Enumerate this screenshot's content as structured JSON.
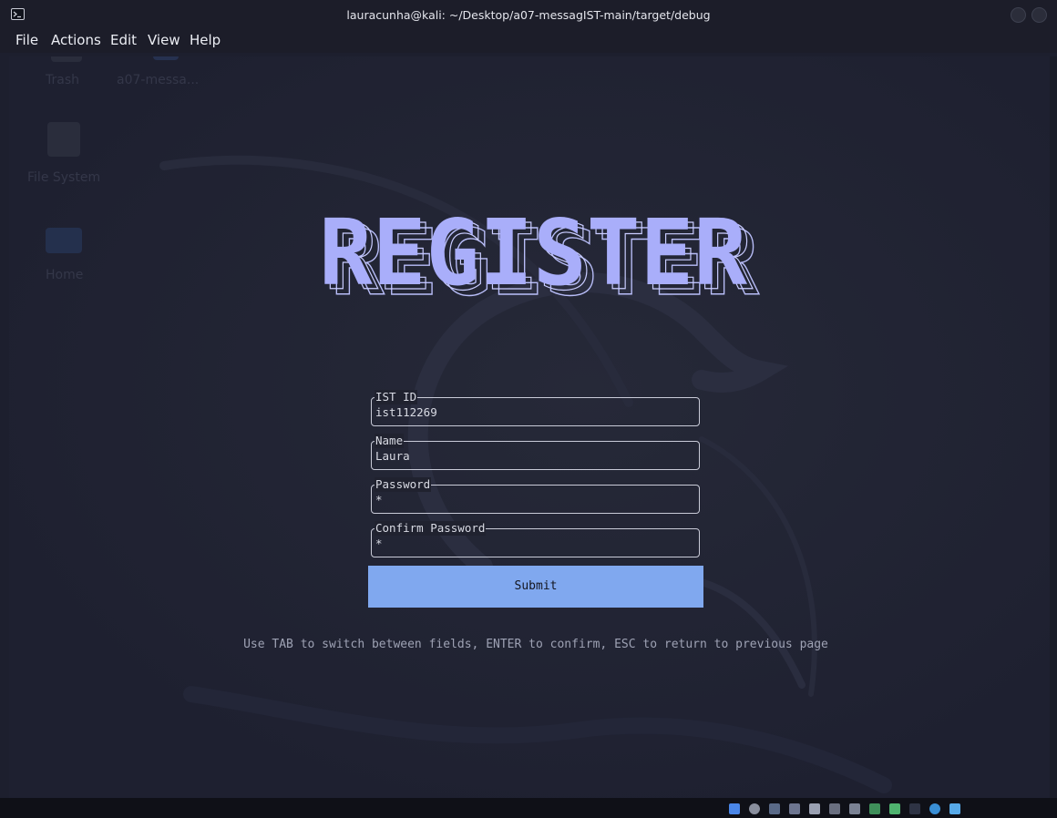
{
  "window": {
    "title": "lauracunha@kali: ~/Desktop/a07-messagIST-main/target/debug"
  },
  "menu": {
    "items": [
      "File",
      "Actions",
      "Edit",
      "View",
      "Help"
    ]
  },
  "desktop_ghosts": {
    "trash": "Trash",
    "folder": "a07-messa...",
    "filesystem": "File System",
    "home": "Home"
  },
  "screen": {
    "banner_text": "REGISTER",
    "fields": [
      {
        "label": "IST ID",
        "value": "ist112269"
      },
      {
        "label": "Name",
        "value": "Laura"
      },
      {
        "label": "Password",
        "value": "*"
      },
      {
        "label": "Confirm Password",
        "value": "*"
      }
    ],
    "submit_label": "Submit",
    "hint": "Use TAB to switch between fields, ENTER to confirm, ESC to return to previous page"
  },
  "colors": {
    "banner_fill": "#a9aefa",
    "banner_outline": "#c9ccff",
    "submit_bg": "#80a8ef",
    "terminal_bg": "#20222f"
  }
}
